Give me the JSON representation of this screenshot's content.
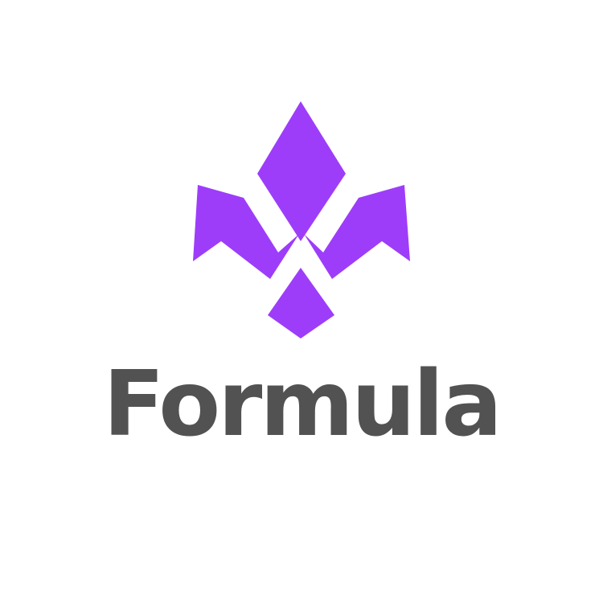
{
  "brand": {
    "name": "Formula",
    "icon": "fleur-de-lis-icon",
    "colors": {
      "mark": "#9D3DF9",
      "wordmark": "#525252",
      "background": "#FFFFFF"
    }
  }
}
